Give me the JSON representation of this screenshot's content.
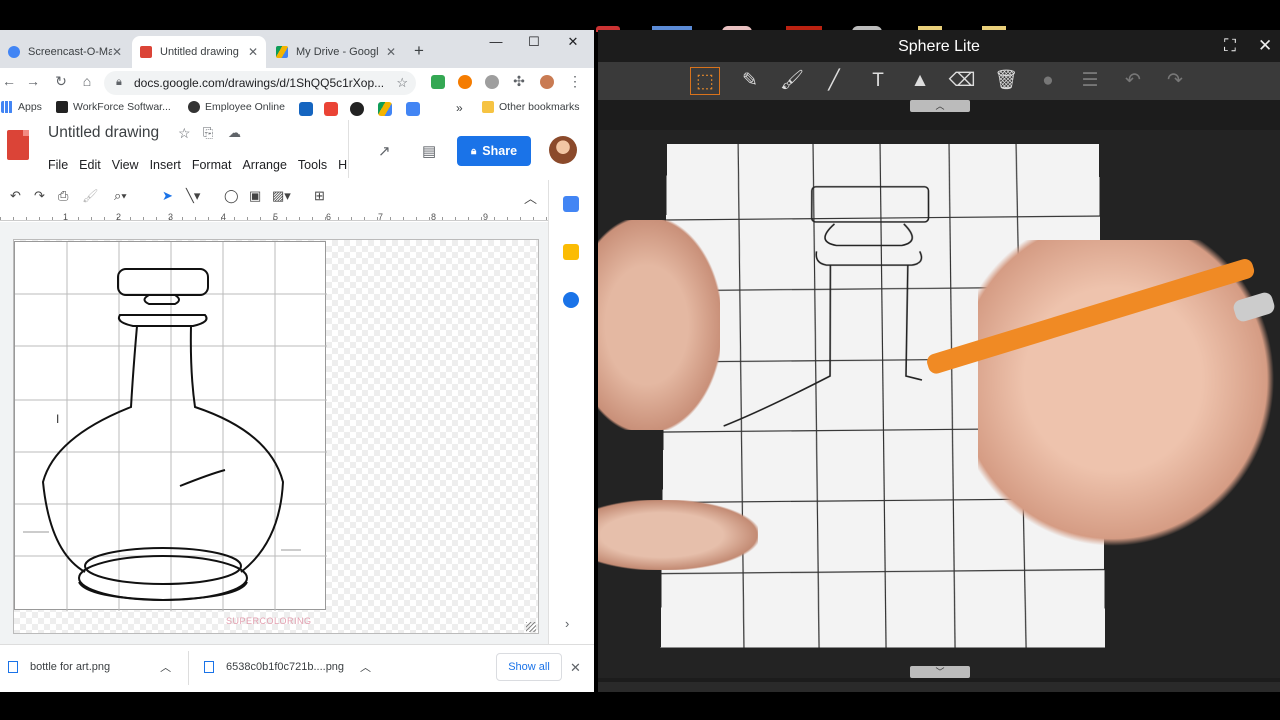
{
  "chrome": {
    "tabs": [
      {
        "label": "Screencast-O-Mat",
        "active": false,
        "color": "#4285f4"
      },
      {
        "label": "Untitled drawing",
        "active": true,
        "color": "#db4437"
      },
      {
        "label": "My Drive - Googl",
        "active": false,
        "color": "#0f9d58"
      }
    ],
    "url": "docs.google.com/drawings/d/1ShQQ5c1rXop...",
    "bookmarks": [
      {
        "label": "Apps"
      },
      {
        "label": "WorkForce Softwar..."
      },
      {
        "label": "Employee Online"
      },
      {
        "label": "Other bookmarks"
      }
    ],
    "bookmarks_more": "»"
  },
  "docs": {
    "title": "Untitled drawing",
    "menu": [
      "File",
      "Edit",
      "View",
      "Insert",
      "Format",
      "Arrange",
      "Tools",
      "H"
    ],
    "share_label": "Share"
  },
  "ruler": [
    "1",
    "2",
    "3",
    "4",
    "5",
    "6",
    "7",
    "8",
    "9"
  ],
  "watermark": "SUPERCOLORING",
  "downloads": {
    "items": [
      {
        "label": "bottle for art.png"
      },
      {
        "label": "6538c0b1f0c721b....png"
      }
    ],
    "show_all": "Show all"
  },
  "sphere": {
    "title": "Sphere Lite"
  },
  "colors": {
    "share_blue": "#1a73e8",
    "docs_red": "#db4437",
    "sphere_active": "#d9731c",
    "pencil_orange": "#f08a24"
  }
}
